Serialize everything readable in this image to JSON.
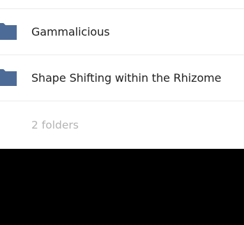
{
  "file_list": {
    "folders": [
      {
        "name": "Gammalicious",
        "icon": "folder-icon"
      },
      {
        "name": "Shape Shifting within the Rhizome",
        "icon": "folder-icon"
      }
    ],
    "summary": "2 folders"
  },
  "colors": {
    "folder": "#4c6b97",
    "text": "#222222",
    "muted": "#b3b3b3",
    "divider": "#ececec"
  }
}
